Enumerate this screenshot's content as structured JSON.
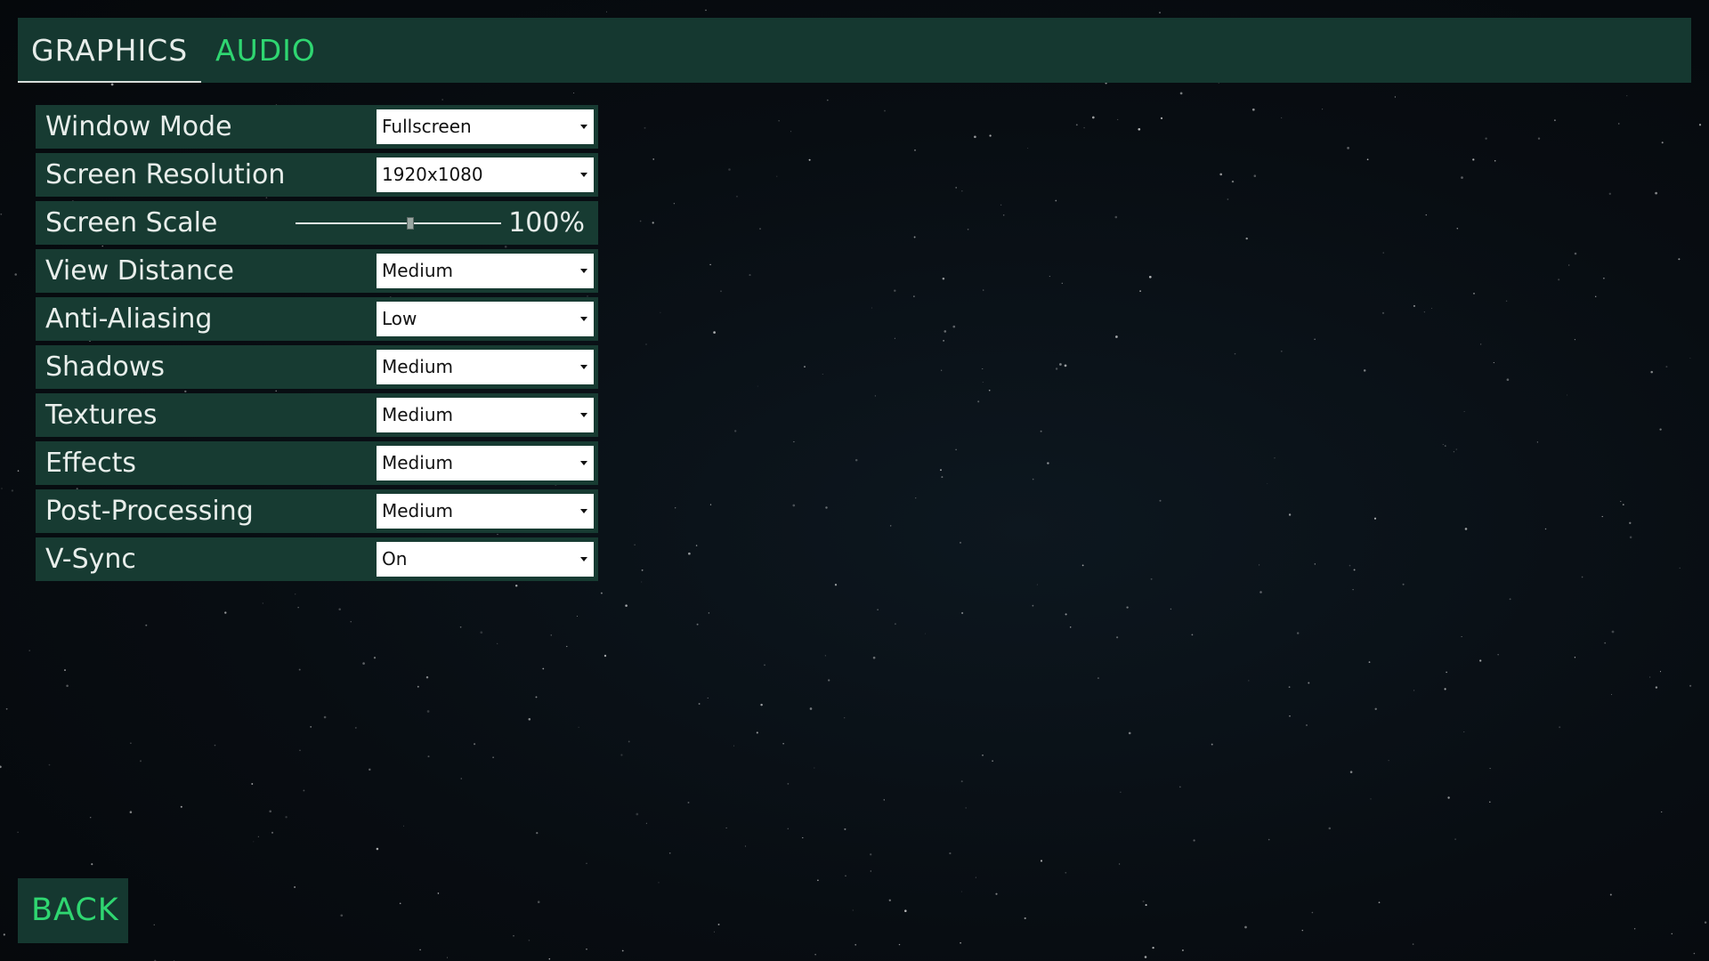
{
  "colors": {
    "panel": "#153830",
    "row": "#173b32",
    "accent": "#2fd671",
    "text": "#e8eeeb",
    "background": "#080d12"
  },
  "tabs": {
    "graphics": "GRAPHICS",
    "audio": "AUDIO"
  },
  "settings": [
    {
      "label": "Window Mode",
      "value": "Fullscreen"
    },
    {
      "label": "Screen Resolution",
      "value": "1920x1080"
    },
    {
      "label": "Screen Scale",
      "value": "100%",
      "slider_fraction": 0.56
    },
    {
      "label": "View Distance",
      "value": "Medium"
    },
    {
      "label": "Anti-Aliasing",
      "value": "Low"
    },
    {
      "label": "Shadows",
      "value": "Medium"
    },
    {
      "label": "Textures",
      "value": "Medium"
    },
    {
      "label": "Effects",
      "value": "Medium"
    },
    {
      "label": "Post-Processing",
      "value": "Medium"
    },
    {
      "label": "V-Sync",
      "value": "On"
    }
  ],
  "back_label": "BACK"
}
